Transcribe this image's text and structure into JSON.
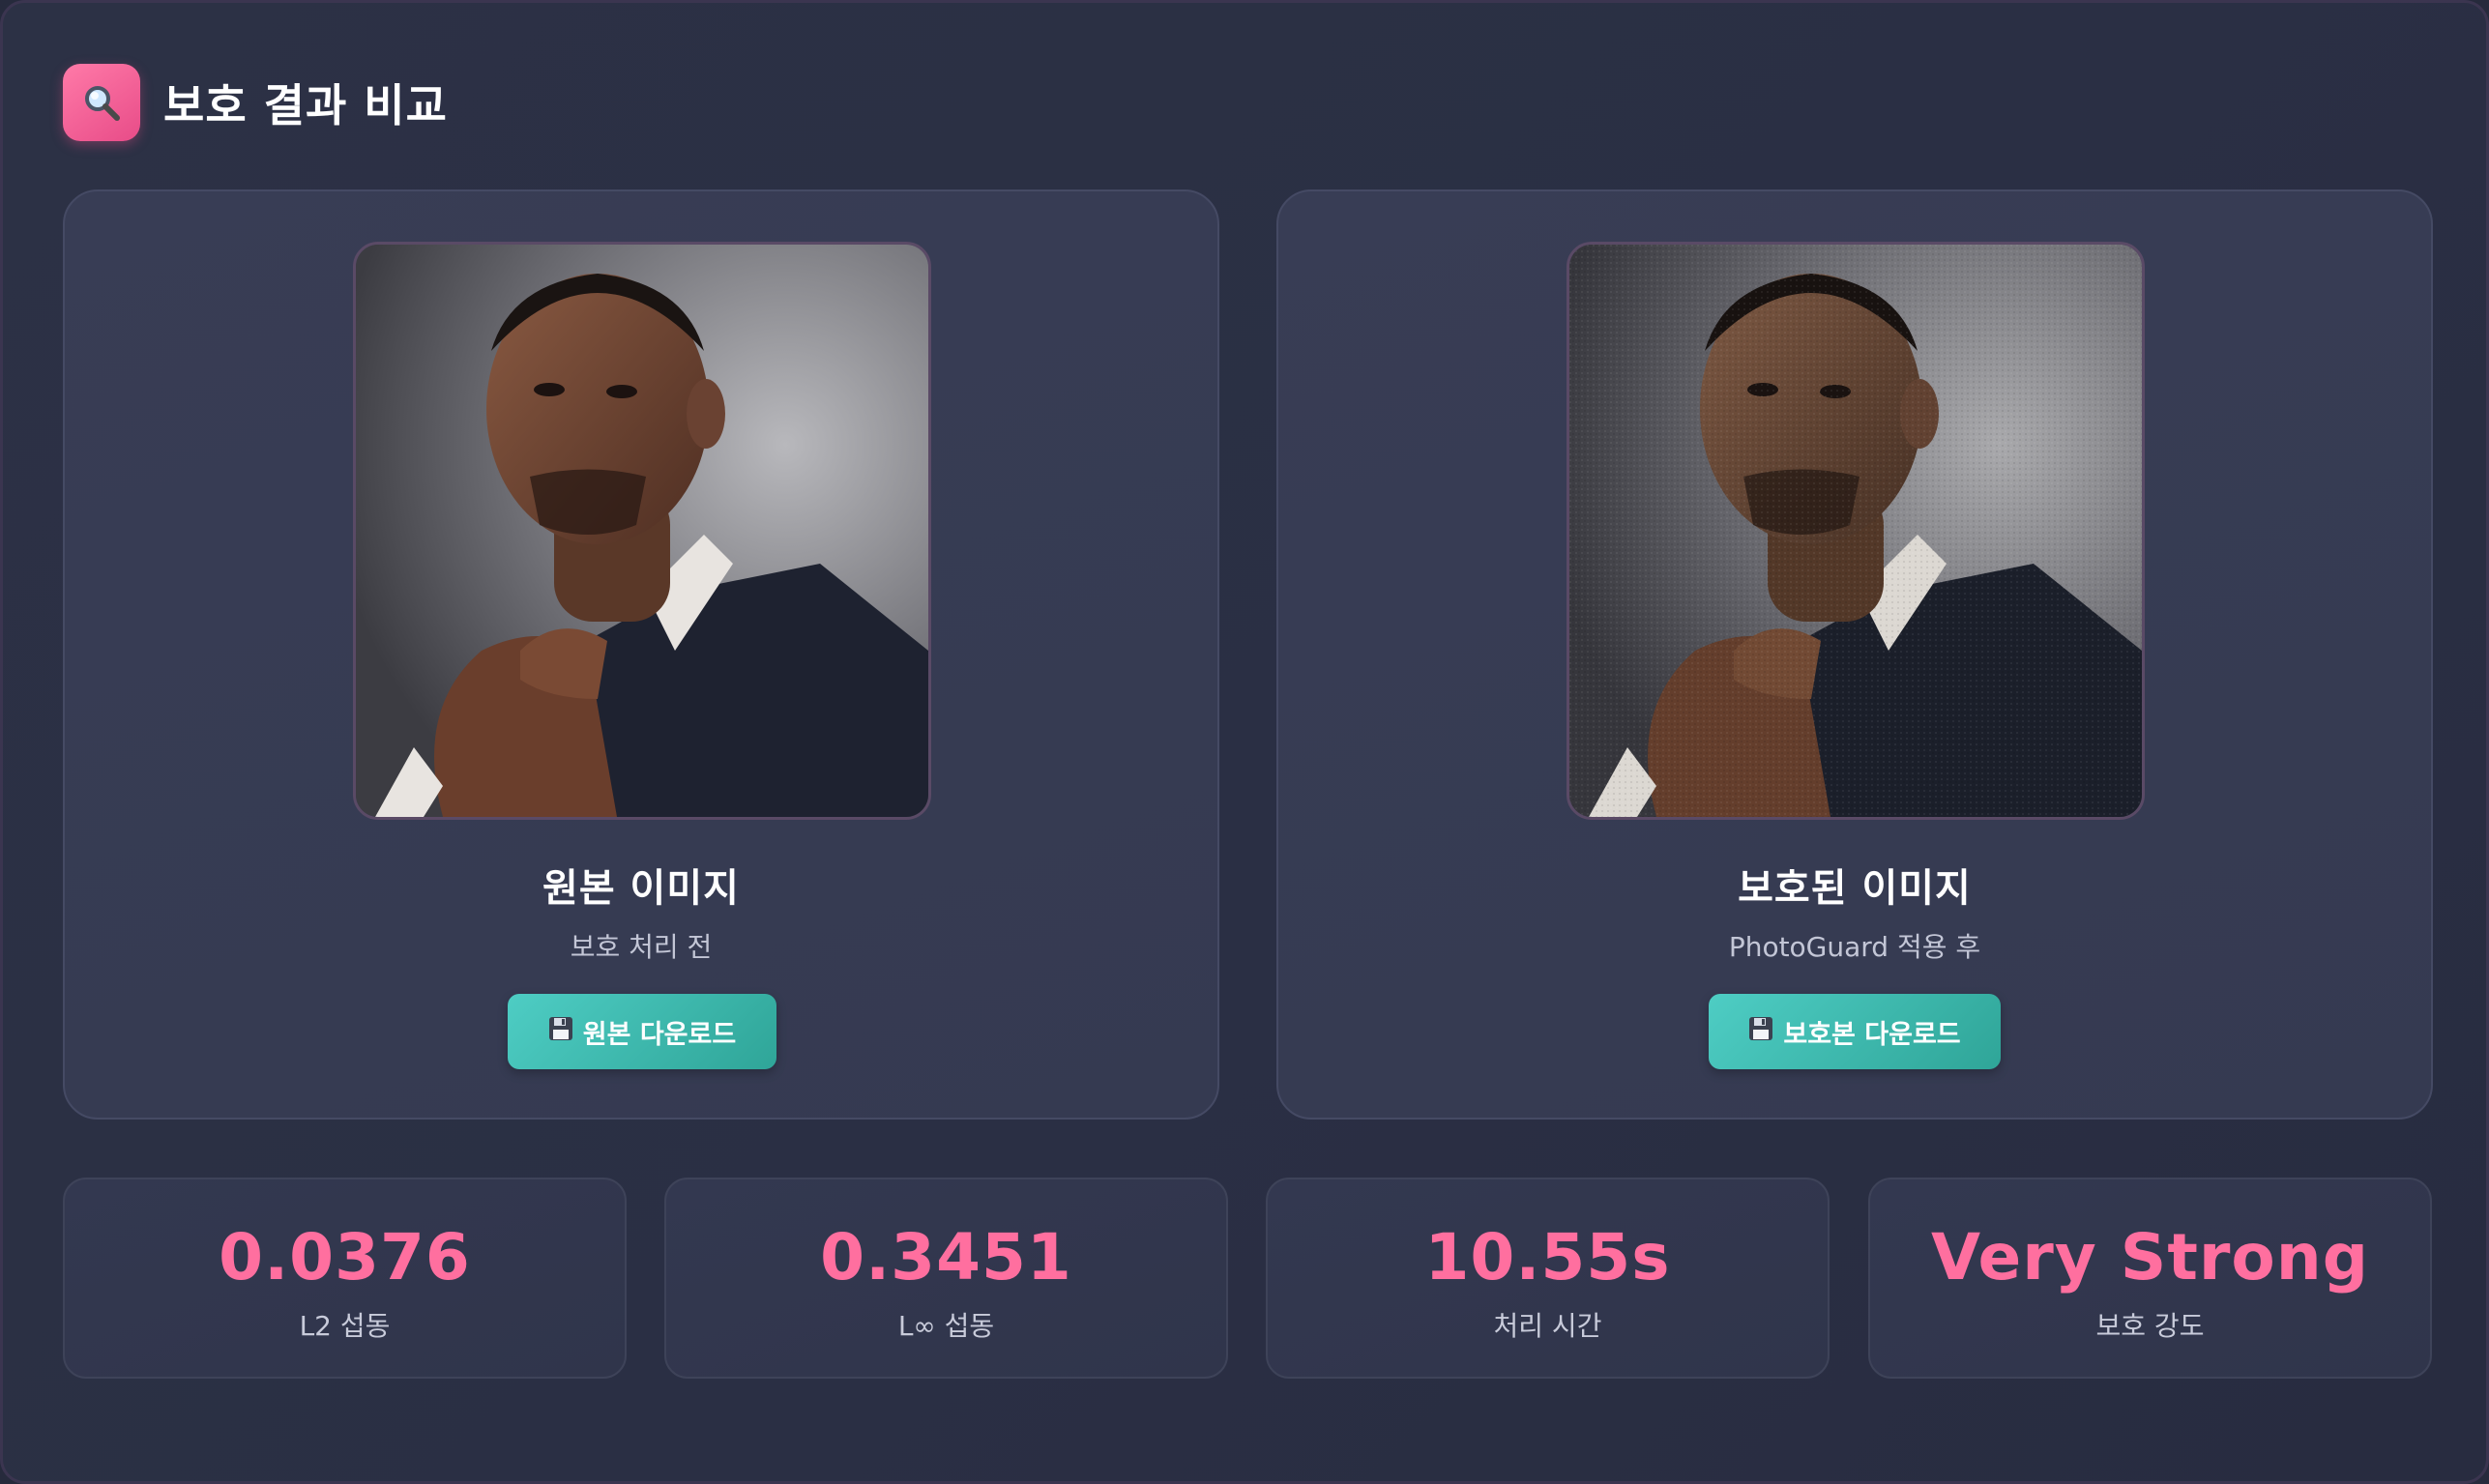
{
  "header": {
    "title": "보호 결과 비교",
    "icon": "magnifier-icon"
  },
  "original": {
    "title": "원본 이미지",
    "subtitle": "보호 처리 전",
    "download_label": "원본 다운로드",
    "download_icon": "floppy-disk-icon"
  },
  "protected": {
    "title": "보호된 이미지",
    "subtitle": "PhotoGuard 적용 후",
    "download_label": "보호본 다운로드",
    "download_icon": "floppy-disk-icon"
  },
  "stats": [
    {
      "value": "0.0376",
      "label": "L2 섭동"
    },
    {
      "value": "0.3451",
      "label": "L∞ 섭동"
    },
    {
      "value": "10.55s",
      "label": "처리 시간"
    },
    {
      "value": "Very Strong",
      "label": "보호 강도"
    }
  ],
  "colors": {
    "accent_pink": "#ff6f9f",
    "button_teal": "#4ecdc4",
    "background": "#262a3c"
  }
}
